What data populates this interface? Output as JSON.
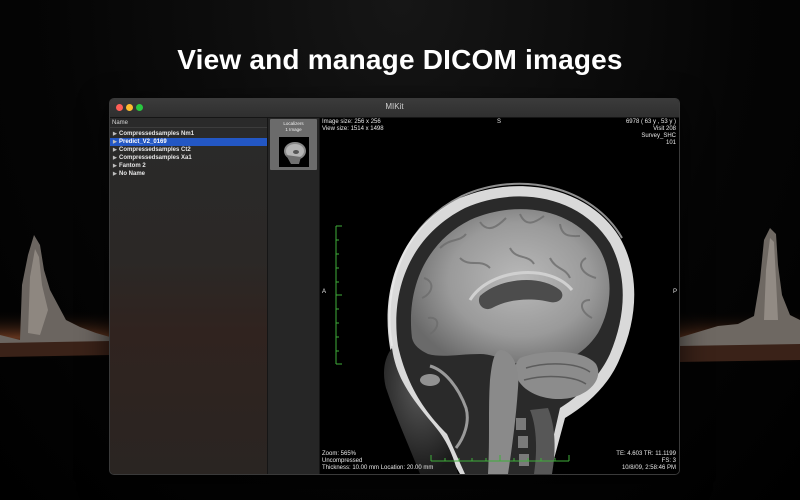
{
  "headline": "View and manage DICOM images",
  "window": {
    "title": "MIKit"
  },
  "sidebar": {
    "column_header": "Name",
    "items": [
      {
        "label": "Compressedsamples Nm1",
        "selected": false
      },
      {
        "label": "Predict_V2_0169",
        "selected": true
      },
      {
        "label": "Compressedsamples Ct2",
        "selected": false
      },
      {
        "label": "Compressedsamples Xa1",
        "selected": false
      },
      {
        "label": "Fantom 2",
        "selected": false
      },
      {
        "label": "No Name",
        "selected": false
      }
    ]
  },
  "thumbnails": [
    {
      "line1": "Localizers",
      "line2": "1 Image"
    }
  ],
  "viewer": {
    "top_left": [
      "Image size: 256 x 256",
      "View size: 1514 x 1498"
    ],
    "top_right": [
      "6978 (  63 y ,  53 y )",
      "Visit 208",
      "Survey_SHC",
      "101"
    ],
    "orientation_top": "S",
    "orientation_left": "A",
    "orientation_right": "P",
    "bottom_left": [
      "Zoom: 565%",
      "Uncompressed",
      "Thickness: 10.00 mm Location: 20.00 mm"
    ],
    "bottom_right": [
      "TE:  4.603 TR:  11.1199",
      "FS:  3",
      "10/8/09, 2:58:46 PM"
    ]
  },
  "colors": {
    "selection": "#2357c4",
    "ruler": "#3fae3a",
    "close": "#ff5f57",
    "minimize": "#febc2e",
    "maximize": "#28c840"
  },
  "icons": [
    "close-icon",
    "minimize-icon",
    "maximize-icon",
    "disclosure-triangle-icon"
  ]
}
